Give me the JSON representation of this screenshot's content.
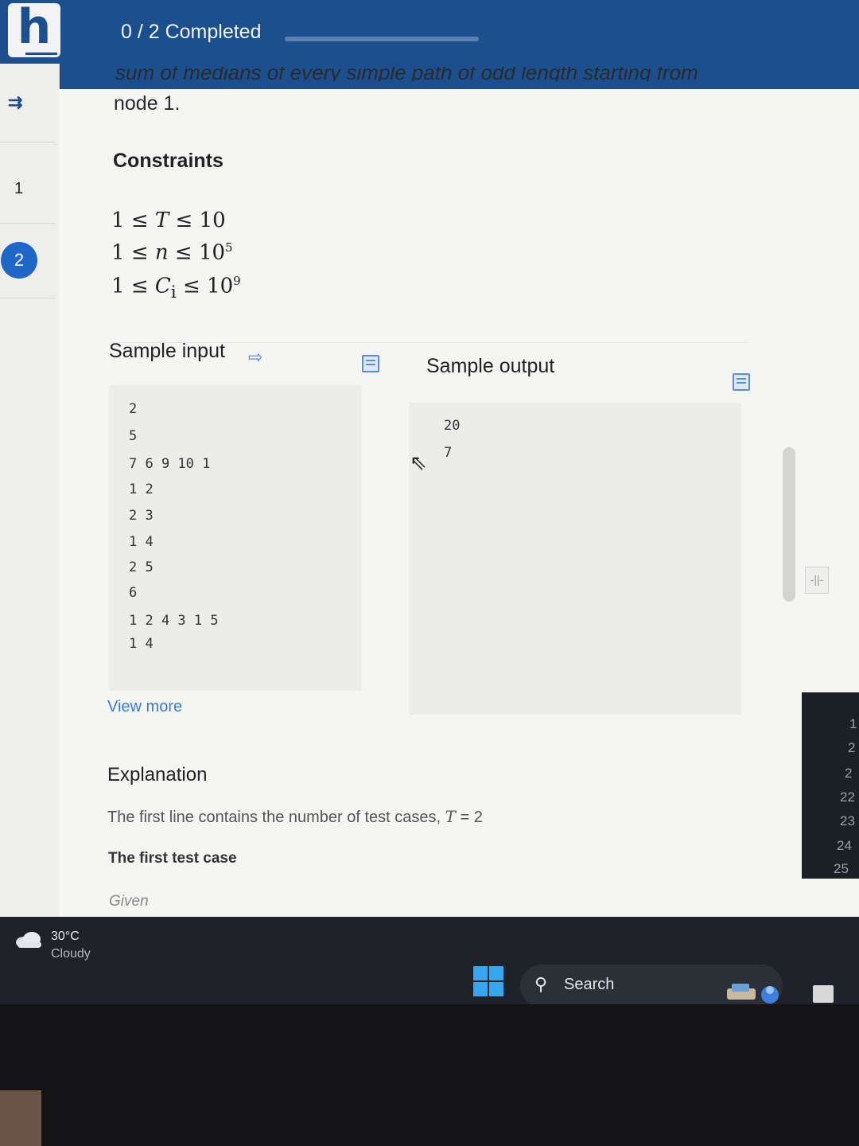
{
  "header": {
    "logo_letter": "h",
    "progress_text": "0 / 2 Completed",
    "progress_fraction": 0
  },
  "sidebar": {
    "icon": "list-arrow-icon",
    "questions": [
      "1",
      "2"
    ],
    "active_question": "2"
  },
  "problem": {
    "statement_clipped": "sum of medians of every simple path of odd length starting from",
    "statement_end": "node 1.",
    "constraints_title": "Constraints",
    "constraints": [
      {
        "lo": "1",
        "var": "T",
        "hi": "10",
        "exp": ""
      },
      {
        "lo": "1",
        "var": "n",
        "hi": "10",
        "exp": "5"
      },
      {
        "lo": "1",
        "var": "C",
        "sub": "i",
        "hi": "10",
        "exp": "9"
      }
    ],
    "leq": "≤",
    "sample_input_title": "Sample input",
    "sample_output_title": "Sample output",
    "sample_input_lines": [
      "2",
      "5",
      "7 6 9 10 1",
      "1 2",
      "2 3",
      "1 4",
      "2 5",
      "6",
      "1 2 4 3 1 5",
      "1 4"
    ],
    "sample_output_lines": [
      "20",
      "7"
    ],
    "view_more": "View more",
    "explanation_title": "Explanation",
    "explanation_text": "The first line contains the number of test cases,",
    "explanation_var": "T",
    "explanation_eq": "= 2",
    "first_case": "The first test case",
    "given": "Given"
  },
  "right_panel": {
    "line_numbers": [
      "1",
      "2",
      "2",
      "22",
      "23",
      "24",
      "25"
    ]
  },
  "taskbar": {
    "weather_temp": "30°C",
    "weather_condition": "Cloudy",
    "search_label": "Search"
  },
  "colors": {
    "brand_blue": "#1c4f8e",
    "active_blue": "#1e66c7",
    "link_blue": "#3a7bd5"
  }
}
